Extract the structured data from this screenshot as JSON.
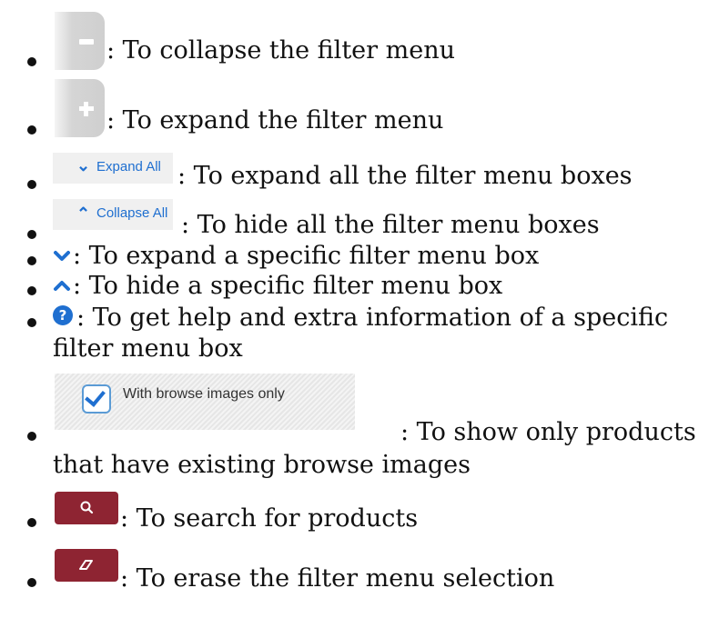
{
  "items": [
    {
      "icon": "minus-icon",
      "text": ": To collapse the filter menu"
    },
    {
      "icon": "plus-icon",
      "text": ": To expand the filter menu"
    },
    {
      "icon": "expand-all-button",
      "button_label": "Expand All",
      "text": ": To expand all the filter menu boxes"
    },
    {
      "icon": "collapse-all-button",
      "button_label": "Collapse All",
      "text": ": To hide all the filter menu boxes"
    },
    {
      "icon": "chevron-down-icon",
      "text": ": To expand a specific filter menu box"
    },
    {
      "icon": "chevron-up-icon",
      "text": ": To hide a specific filter menu box"
    },
    {
      "icon": "help-icon",
      "text": ": To get help and extra information of a specific",
      "text_line2": "filter menu box"
    },
    {
      "icon": "checkbox-icon",
      "checkbox_label": "With browse images only",
      "text": ": To show only products",
      "text_line2": "that have existing browse images"
    },
    {
      "icon": "search-icon",
      "text": ": To search for products"
    },
    {
      "icon": "eraser-icon",
      "text": ": To erase the filter menu selection"
    }
  ],
  "colors": {
    "accent": "#1f6fd0",
    "button_red": "#8e2432",
    "button_grey": "#d5d5d5"
  }
}
